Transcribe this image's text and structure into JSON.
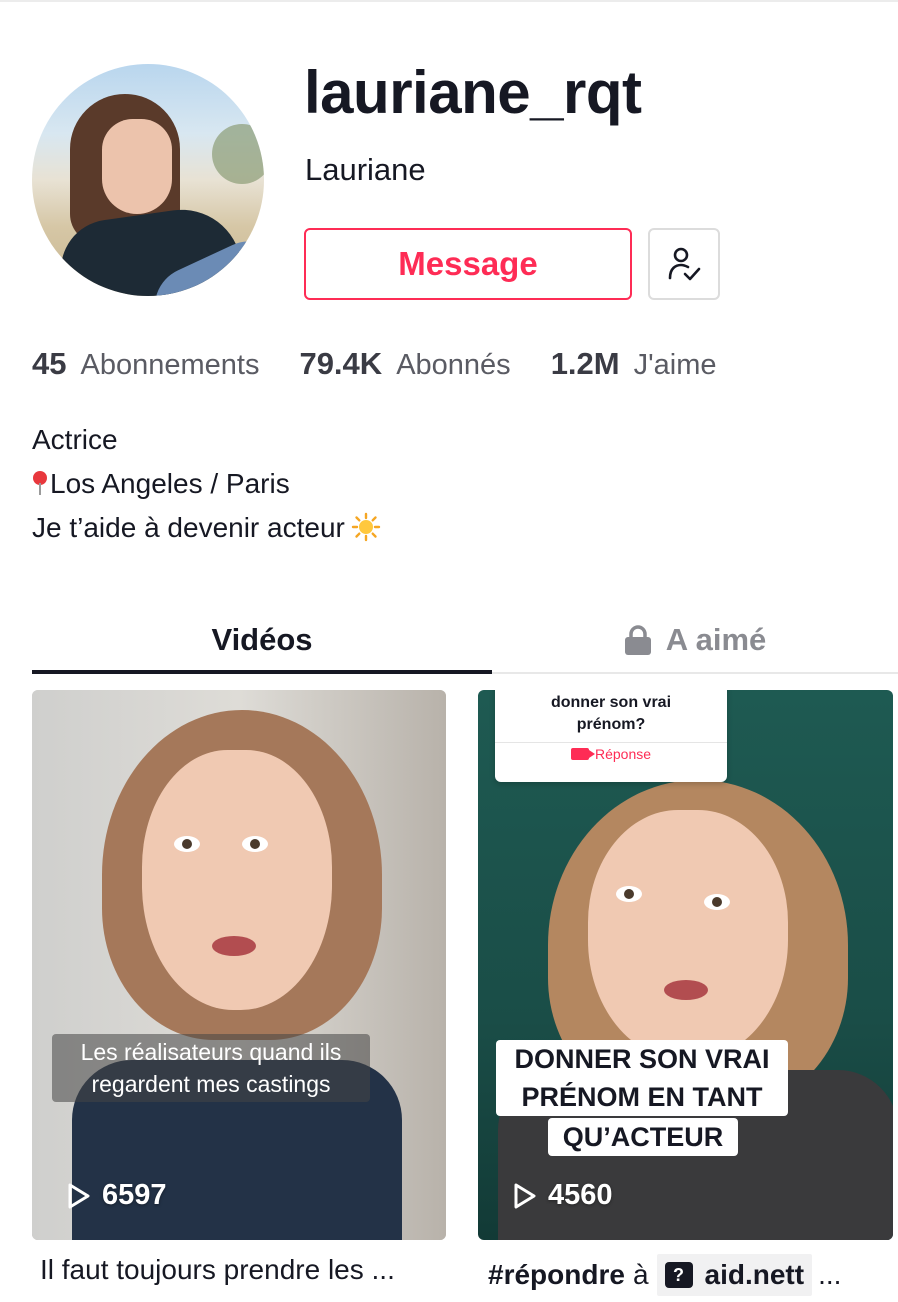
{
  "profile": {
    "username": "lauriane_rqt",
    "display_name": "Lauriane",
    "message_label": "Message"
  },
  "stats": [
    {
      "value": "45",
      "label": "Abonnements"
    },
    {
      "value": "79.4K",
      "label": "Abonnés"
    },
    {
      "value": "1.2M",
      "label": "J'aime"
    }
  ],
  "bio": {
    "line1": "Actrice",
    "line2": "Los Angeles / Paris",
    "line3": "Je t’aide à devenir acteur"
  },
  "tabs": {
    "videos": "Vidéos",
    "liked": "A aimé"
  },
  "videos": [
    {
      "caption_line1": "Les réalisateurs quand ils",
      "caption_line2": "regardent mes castings",
      "views": "6597",
      "description": "Il faut toujours prendre les ..."
    },
    {
      "qa_question_line1": "donner son vrai",
      "qa_question_line2": "prénom?",
      "qa_reply": "Réponse",
      "caption_line1": "DONNER SON VRAI",
      "caption_line2": "PRÉNOM EN TANT",
      "caption_line3": "QU’ACTEUR",
      "views": "4560",
      "hashtag": "#répondre",
      "connector": "à",
      "mention": "aid.nett",
      "ellipsis": "..."
    }
  ],
  "colors": {
    "accent": "#fe2c55",
    "text": "#161823",
    "muted": "#8a8b91"
  },
  "icons": {
    "follow": "person-check-icon",
    "lock": "lock-icon",
    "play": "play-icon",
    "location": "pin-icon",
    "sun": "sun-icon",
    "question": "question-icon"
  }
}
